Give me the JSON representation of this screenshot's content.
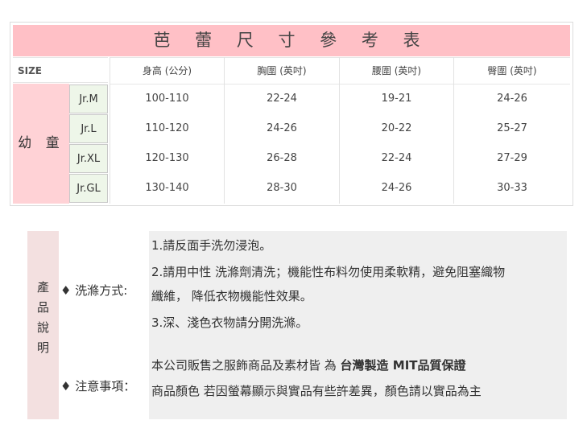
{
  "size_chart": {
    "title": "芭 蕾 尺 寸 參 考 表",
    "header": {
      "size": "SIZE",
      "height": "身高 (公分)",
      "chest": "胸圍 (英吋)",
      "waist": "腰圍 (英吋)",
      "hip": "臀圍 (英吋)"
    },
    "group_label": "幼 童",
    "rows": [
      {
        "size": "Jr.M",
        "height": "100-110",
        "chest": "22-24",
        "waist": "19-21",
        "hip": "24-26"
      },
      {
        "size": "Jr.L",
        "height": "110-120",
        "chest": "24-26",
        "waist": "20-22",
        "hip": "25-27"
      },
      {
        "size": "Jr.XL",
        "height": "120-130",
        "chest": "26-28",
        "waist": "22-24",
        "hip": "27-29"
      },
      {
        "size": "Jr.GL",
        "height": "130-140",
        "chest": "28-30",
        "waist": "24-26",
        "hip": "30-33"
      }
    ]
  },
  "notes": {
    "side_label": "產\n品\n說\n明",
    "washing": {
      "label": "♦ 洗滌方式:",
      "lines": [
        "1.請反面手洗勿浸泡。",
        "2.請用中性 洗滌劑清洗；機能性布料勿使用柔軟精，避免阻塞織物",
        "纖維， 降低衣物機能性效果。",
        "3.深、淺色衣物請分開洗滌。"
      ]
    },
    "caution": {
      "label": "♦ 注意事項：",
      "line1_prefix": "本公司販售之服飾商品及素材皆 為 ",
      "line1_bold": "台灣製造 MIT品質保證",
      "line2": "商品顏色 若因螢幕顯示與實品有些許差異，顏色請以實品為主"
    }
  }
}
